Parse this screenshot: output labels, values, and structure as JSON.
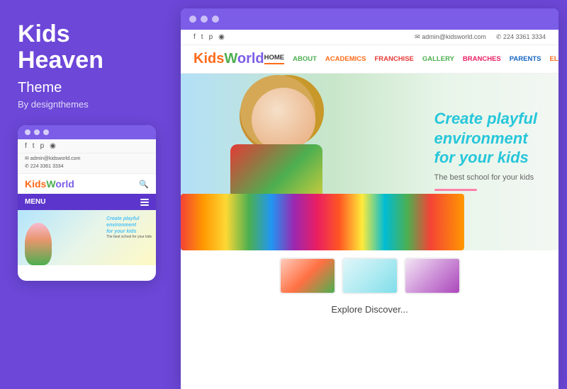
{
  "left": {
    "title": "Kids\nHeaven",
    "subtitle": "Theme",
    "by": "By designthemes",
    "mobile": {
      "email": "✉ admin@kidsworld.com",
      "phone": "✆ 224 3361 3334",
      "menu_label": "MENU",
      "logo_kids": "Kids",
      "logo_world": "World",
      "hero_line1": "Create playful\nenvironment\nfor your kids"
    }
  },
  "browser": {
    "topbar": {
      "email": "✉ admin@kidsworld.com",
      "phone": "✆ 224 3361 3334"
    },
    "logo": "KidsWorld",
    "nav": {
      "home": "HOME",
      "about": "ABOUT",
      "academics": "ACADEMICS",
      "franchise": "FRANCHISE",
      "gallery": "GALLERY",
      "branches": "BRANCHES",
      "parents": "PARENTS",
      "elements": "ELEMENTS"
    },
    "hero": {
      "tagline": "Create playful\nenvironment\nfor your kids",
      "subtext": "The best school for your kids"
    },
    "section_title": "Explore Discover..."
  }
}
